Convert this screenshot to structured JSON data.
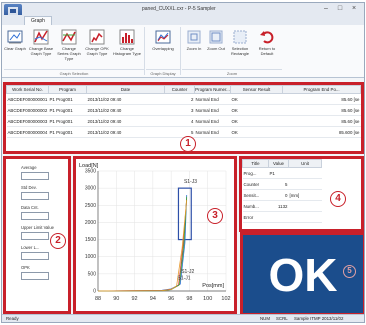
{
  "window": {
    "title": "paned_CUXXL.cxr - P-5 Sampler",
    "controls": [
      "–",
      "□",
      "×"
    ]
  },
  "ribbon": {
    "tab": "Graph",
    "buttons": [
      {
        "label": "Clear Graph",
        "icon": "clear-graph-icon"
      },
      {
        "label": "Change Base Graph Type",
        "icon": "base-graph-icon"
      },
      {
        "label": "Change Series Graph Type",
        "icon": "series-graph-icon"
      },
      {
        "label": "Change OPK Graph Type",
        "icon": "opk-graph-icon"
      },
      {
        "label": "Change Histogram Type",
        "icon": "histogram-icon"
      },
      {
        "label": "Overlapping",
        "icon": "overlapping-icon"
      },
      {
        "label": "Zoom In",
        "icon": "zoom-in-icon"
      },
      {
        "label": "Zoom Out",
        "icon": "zoom-out-icon"
      },
      {
        "label": "Selection Rectangle",
        "icon": "selection-rectangle-icon"
      },
      {
        "label": "Return to Default",
        "icon": "return-default-icon"
      }
    ],
    "groups": [
      "Graph Selection",
      "Graph Display",
      "Zoom"
    ]
  },
  "table": {
    "columns": [
      "Work Serial No.",
      "Program",
      "Date",
      "Counter",
      "Program Numer...",
      "Sensor Result",
      "Program End Po..."
    ],
    "rows": [
      [
        "ABCDEF000000001",
        "P1 Prog001",
        "2013/11/02 09:40",
        "2",
        "Normal End",
        "OK",
        "85.60 [se"
      ],
      [
        "ABCDEF000000002",
        "P1 Prog001",
        "2013/11/02 09:40",
        "3",
        "Normal End",
        "OK",
        "85.60 [se"
      ],
      [
        "ABCDEF000000003",
        "P1 Prog001",
        "2013/11/02 09:40",
        "4",
        "Normal End",
        "OK",
        "85.60 [se"
      ],
      [
        "ABCDEF000000004",
        "P1 Prog001",
        "2013/11/02 09:40",
        "5",
        "Normal End",
        "OK",
        "85.600 [se"
      ]
    ]
  },
  "fields": [
    {
      "label": "Average"
    },
    {
      "label": "Std Dev."
    },
    {
      "label": "Data Cnt."
    },
    {
      "label": "Upper Limit Value"
    },
    {
      "label": "Lower L..."
    },
    {
      "label": "OPK"
    }
  ],
  "chart_data": {
    "type": "line",
    "ylabel": "Load[N]",
    "xlabel": "Pos[mm]",
    "y_ticks": [
      "3500",
      "3000",
      "2500",
      "2000",
      "1500",
      "1000",
      "500",
      "0"
    ],
    "x_ticks": [
      "88",
      "90",
      "92",
      "94",
      "96",
      "98",
      "100",
      "102"
    ],
    "xlim": [
      88,
      102
    ],
    "ylim": [
      0,
      3500
    ],
    "annotations": [
      "S1-J3",
      "S1-J2",
      "S1-J1"
    ],
    "series": [
      {
        "color": "#2e6fd6",
        "x": [
          88,
          95,
          96,
          97,
          97.5,
          97.7
        ],
        "y": [
          0,
          20,
          60,
          200,
          1400,
          2800
        ]
      },
      {
        "color": "#d94040",
        "x": [
          88,
          95,
          96,
          96.8,
          97.3,
          97.7
        ],
        "y": [
          0,
          15,
          50,
          160,
          1300,
          2700
        ]
      },
      {
        "color": "#3aa33a",
        "x": [
          88,
          95,
          96,
          96.9,
          97.4,
          97.7
        ],
        "y": [
          0,
          10,
          40,
          180,
          1350,
          2750
        ]
      },
      {
        "color": "#e89a2e",
        "x": [
          88,
          95,
          96,
          96.6,
          97.2,
          97.7
        ],
        "y": [
          0,
          12,
          45,
          150,
          1250,
          2650
        ]
      }
    ],
    "judgment_box": {
      "x": [
        96.8,
        98.2
      ],
      "y": [
        1500,
        3000
      ],
      "color": "#2d4fa8"
    }
  },
  "results": {
    "columns": [
      "Title",
      "Value",
      "Unit"
    ],
    "rows": [
      [
        "Prog...",
        "P1",
        ""
      ],
      [
        "Counter",
        "5",
        ""
      ],
      [
        "Sensit...",
        "0",
        "[mm]"
      ],
      [
        "Numb...",
        "1132",
        ""
      ],
      [
        "Error",
        "",
        ""
      ]
    ]
  },
  "ok_label": "OK",
  "markers": [
    "1",
    "2",
    "3",
    "4",
    "5"
  ],
  "status": {
    "left": "Ready",
    "right": [
      "NUM",
      "SCRL",
      "Sample ITMP 2013/11/02"
    ]
  }
}
